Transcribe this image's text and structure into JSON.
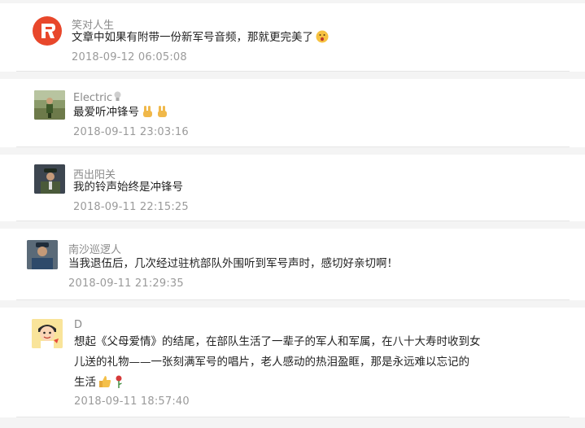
{
  "comments": [
    {
      "name": "笑对人生",
      "content": "文章中如果有附带一份新军号音频，那就更完美了",
      "time": "2018-09-12 06:05:08",
      "avatar_icon": "red-flag-logo",
      "trailing_icons": [
        "surprised-face-emoji"
      ]
    },
    {
      "name": "Electric",
      "name_icon": "lightbulb-icon",
      "content": "最爱听冲锋号",
      "time": "2018-09-11 23:03:16",
      "avatar_icon": "soldier-photo",
      "trailing_icons": [
        "victory-hand-emoji",
        "victory-hand-emoji"
      ]
    },
    {
      "name": "西出阳关",
      "content": "我的铃声始终是冲锋号",
      "time": "2018-09-11 22:15:25",
      "avatar_icon": "officer-photo",
      "trailing_icons": []
    },
    {
      "name": "南沙巡逻人",
      "content": "当我退伍后，几次经过驻杭部队外围听到军号声时，感切好亲切啊！",
      "time": "2018-09-11 21:29:35",
      "avatar_icon": "man-photo",
      "trailing_icons": []
    },
    {
      "name": "D",
      "content_lines": [
        "想起《父母爱情》的结尾，在部队生活了一辈子的军人和军属，在八十大寿时收到女",
        "儿送的礼物——一张刻满军号的唱片，老人感动的热泪盈眶，那是永远难以忘记的",
        "生活"
      ],
      "time": "2018-09-11 18:57:40",
      "avatar_icon": "cartoon-avatar",
      "trailing_icons": [
        "thumbs-up-emoji",
        "rose-emoji"
      ]
    }
  ],
  "colors": {
    "name": "#8a8a8a",
    "content": "#222222",
    "time": "#9a9a9a",
    "separator": "#f4f4f4",
    "logo_red": "#e8472b"
  }
}
